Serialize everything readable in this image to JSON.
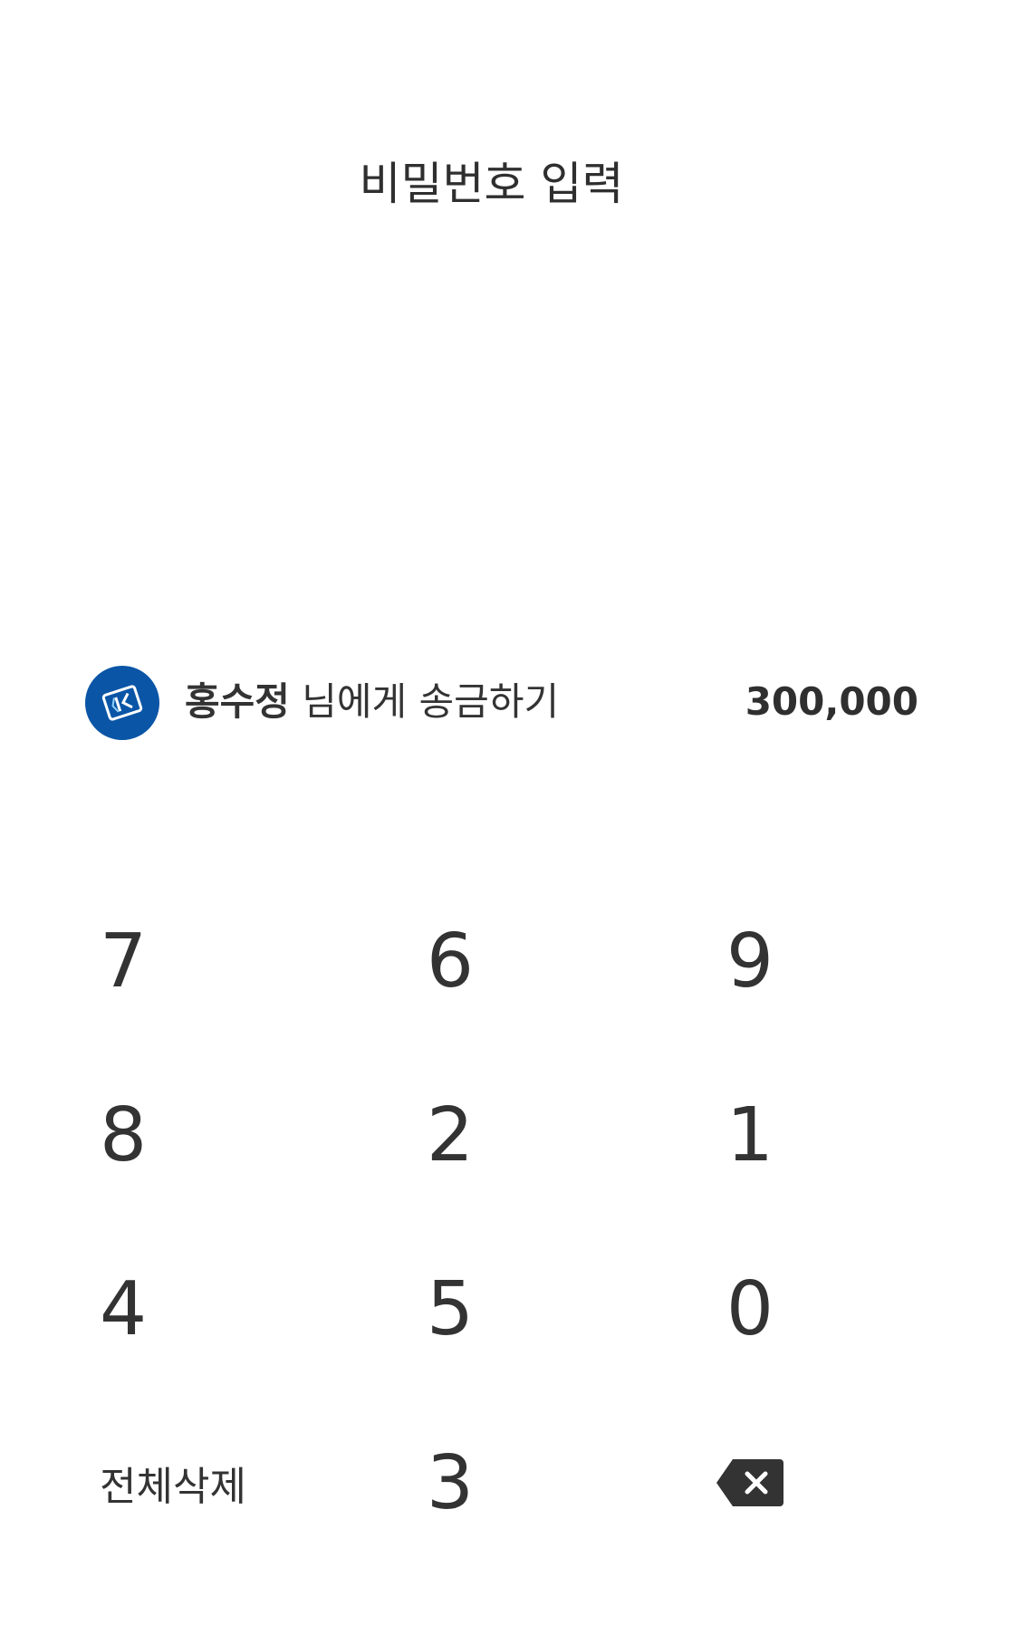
{
  "header": {
    "title": "비밀번호 입력"
  },
  "transfer": {
    "bank_logo_icon": "bank-logo-icon",
    "recipient_name": "홍수정",
    "action_text": " 님에게 송금하기",
    "amount": "300,000"
  },
  "keypad": {
    "rows": [
      [
        "7",
        "6",
        "9"
      ],
      [
        "8",
        "2",
        "1"
      ],
      [
        "4",
        "5",
        "0"
      ]
    ],
    "delete_all_label": "전체삭제",
    "bottom_digit": "3",
    "backspace_icon": "backspace-icon"
  },
  "colors": {
    "text": "#333333",
    "bank_logo_bg": "#0a55a6",
    "background": "#ffffff"
  }
}
